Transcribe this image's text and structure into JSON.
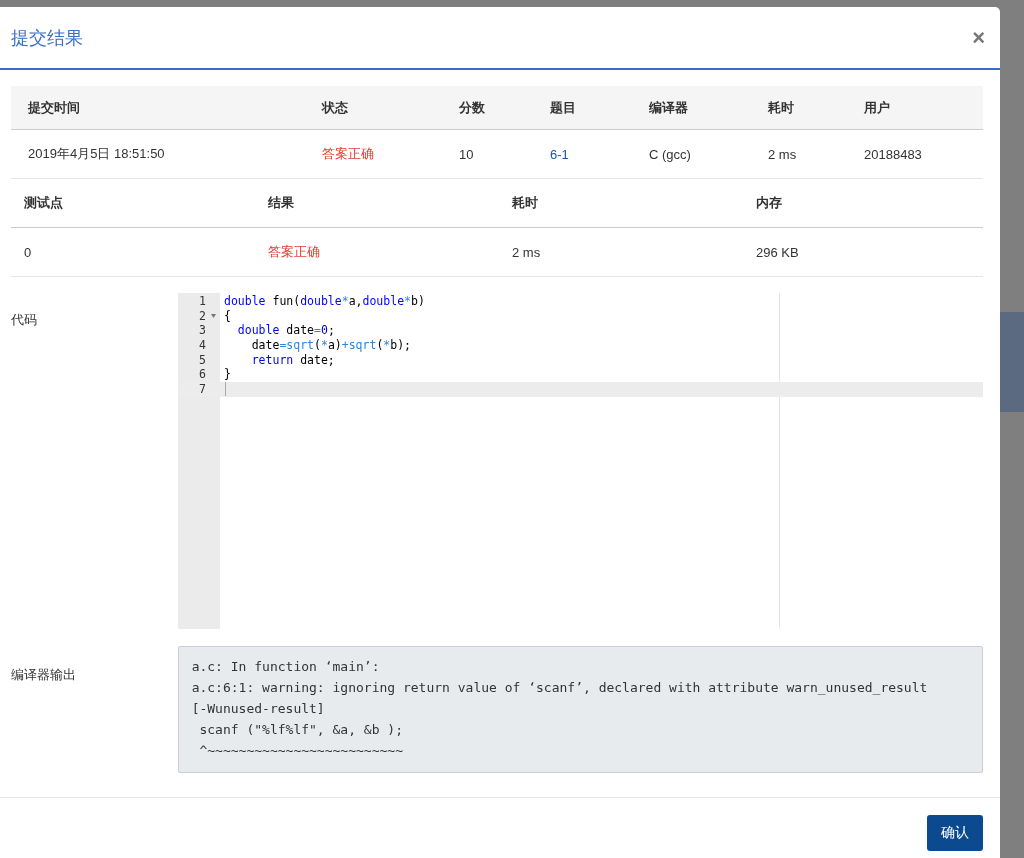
{
  "dialog": {
    "title": "提交结果",
    "close": "×"
  },
  "submission": {
    "columns": [
      "提交时间",
      "状态",
      "分数",
      "题目",
      "编译器",
      "耗时",
      "用户"
    ],
    "row": [
      {
        "kind": "text",
        "text": "2019年4月5日 18:51:50"
      },
      {
        "kind": "status",
        "text": "答案正确"
      },
      {
        "kind": "text",
        "text": "10"
      },
      {
        "kind": "link",
        "text": "6-1"
      },
      {
        "kind": "text",
        "text": "C (gcc)"
      },
      {
        "kind": "text",
        "text": "2 ms"
      },
      {
        "kind": "text",
        "text": "20188483"
      }
    ]
  },
  "testcases": {
    "columns": [
      "测试点",
      "结果",
      "耗时",
      "内存"
    ],
    "rows": [
      [
        {
          "kind": "text",
          "text": "0"
        },
        {
          "kind": "status",
          "text": "答案正确"
        },
        {
          "kind": "text",
          "text": "2 ms"
        },
        {
          "kind": "text",
          "text": "296 KB"
        }
      ]
    ]
  },
  "code": {
    "label": "代码",
    "lines": [
      {
        "number": "1",
        "fold": false,
        "active": false,
        "tokens": [
          {
            "kind": "kw",
            "text": "double"
          },
          {
            "kind": "txt",
            "text": " fun("
          },
          {
            "kind": "kw",
            "text": "double"
          },
          {
            "kind": "op",
            "text": "*"
          },
          {
            "kind": "txt",
            "text": "a,"
          },
          {
            "kind": "kw",
            "text": "double"
          },
          {
            "kind": "op",
            "text": "*"
          },
          {
            "kind": "txt",
            "text": "b)"
          }
        ]
      },
      {
        "number": "2",
        "fold": true,
        "active": false,
        "tokens": [
          {
            "kind": "txt",
            "text": "{"
          }
        ]
      },
      {
        "number": "3",
        "fold": false,
        "active": false,
        "tokens": [
          {
            "kind": "kw",
            "text": "  double"
          },
          {
            "kind": "txt",
            "text": " date"
          },
          {
            "kind": "op",
            "text": "="
          },
          {
            "kind": "num",
            "text": "0"
          },
          {
            "kind": "txt",
            "text": ";"
          }
        ]
      },
      {
        "number": "4",
        "fold": false,
        "active": false,
        "tokens": [
          {
            "kind": "txt",
            "text": "    date"
          },
          {
            "kind": "op",
            "text": "=sqrt"
          },
          {
            "kind": "txt",
            "text": "("
          },
          {
            "kind": "op",
            "text": "*"
          },
          {
            "kind": "txt",
            "text": "a)"
          },
          {
            "kind": "op",
            "text": "+sqrt"
          },
          {
            "kind": "txt",
            "text": "("
          },
          {
            "kind": "op",
            "text": "*"
          },
          {
            "kind": "txt",
            "text": "b);"
          }
        ]
      },
      {
        "number": "5",
        "fold": false,
        "active": false,
        "tokens": [
          {
            "kind": "kw",
            "text": "    return"
          },
          {
            "kind": "txt",
            "text": " date;"
          }
        ]
      },
      {
        "number": "6",
        "fold": false,
        "active": false,
        "tokens": [
          {
            "kind": "txt",
            "text": "}"
          }
        ]
      },
      {
        "number": "7",
        "fold": false,
        "active": true
      }
    ]
  },
  "compiler_output": {
    "label": "编译器输出",
    "lines": [
      "a.c: In function ‘main’:",
      "a.c:6:1: warning: ignoring return value of ‘scanf’, declared with attribute warn_unused_result",
      "[-Wunused-result]",
      " scanf (\"%lf%lf\", &a, &b );",
      " ^~~~~~~~~~~~~~~~~~~~~~~~~~"
    ]
  },
  "footer": {
    "confirm": "确认"
  }
}
